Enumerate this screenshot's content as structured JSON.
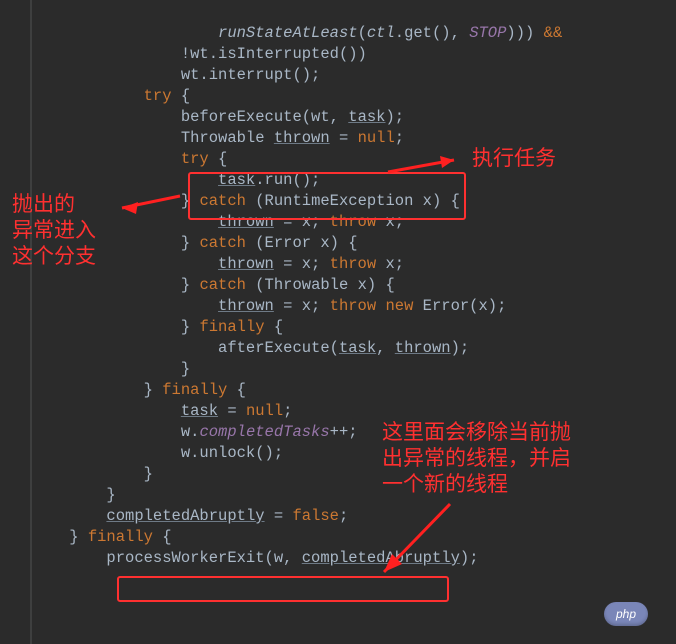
{
  "code": {
    "line1": "                    runStateAtLeast(ctl.get(), STOP))) &&",
    "line2": "                !wt.isInterrupted())",
    "line3": "                wt.interrupt();",
    "line4": "            try {",
    "line5": "                beforeExecute(wt, task);",
    "line6": "                Throwable thrown = null;",
    "line7": "                try {",
    "line8": "                    task.run();",
    "line9": "                } catch (RuntimeException x) {",
    "line10": "                    thrown = x; throw x;",
    "line11": "                } catch (Error x) {",
    "line12": "                    thrown = x; throw x;",
    "line13": "                } catch (Throwable x) {",
    "line14": "                    thrown = x; throw new Error(x);",
    "line15": "                } finally {",
    "line16": "                    afterExecute(task, thrown);",
    "line17": "                }",
    "line18": "            } finally {",
    "line19": "                task = null;",
    "line20": "                w.completedTasks++;",
    "line21": "                w.unlock();",
    "line22": "            }",
    "line23": "        }",
    "line24": "        completedAbruptly = false;",
    "line25": "    } finally {",
    "line26": "        processWorkerExit(w, completedAbruptly);",
    "line27": ""
  },
  "annotations": {
    "exec_task": "执行任务",
    "exception_branch_l1": "抛出的",
    "exception_branch_l2": "异常进入",
    "exception_branch_l3": "这个分支",
    "bottom_l1": "这里面会移除当前抛",
    "bottom_l2": "出异常的线程，并启",
    "bottom_l3": "一个新的线程"
  },
  "badge": {
    "text": "php"
  }
}
